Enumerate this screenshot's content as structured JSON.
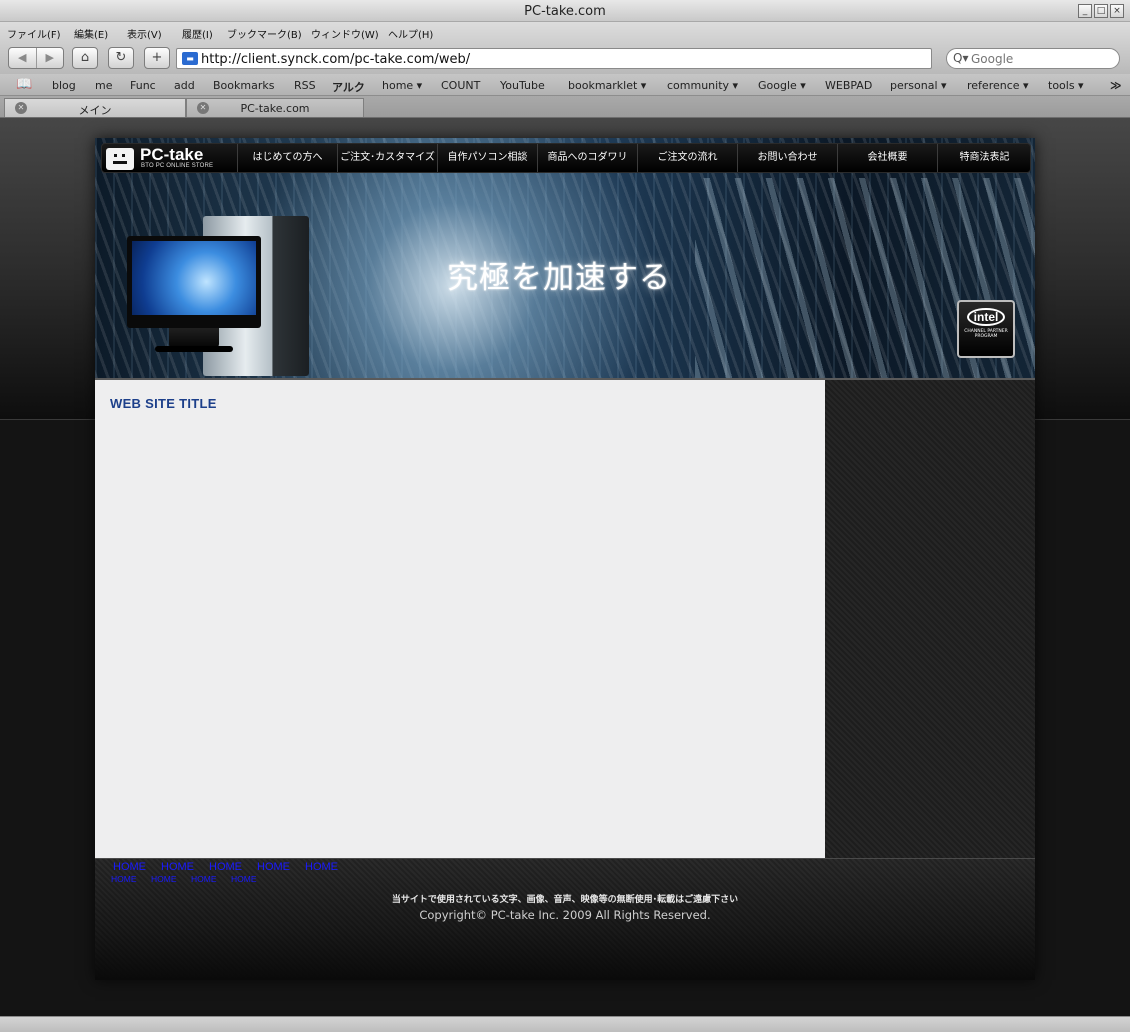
{
  "window": {
    "title": "PC-take.com",
    "buttons": [
      "_",
      "□",
      "×"
    ]
  },
  "menubar": [
    "ファイル(F)",
    "編集(E)",
    "表示(V)",
    "履歴(I)",
    "ブックマーク(B)",
    "ウィンドウ(W)",
    "ヘルプ(H)"
  ],
  "toolbar": {
    "back_icon": "◀",
    "forward_icon": "▶",
    "home_icon": "⌂",
    "reload_icon": "↻",
    "add_icon": "+",
    "url": "http://client.synck.com/pc-take.com/web/",
    "search_placeholder": "Google",
    "search_icon": "Q▾"
  },
  "bookmarks": [
    "blog",
    "me",
    "Func",
    "add",
    "Bookmarks",
    "RSS",
    "アルク",
    "home ▾",
    "COUNT",
    "YouTube",
    "bookmarklet ▾",
    "community ▾",
    "Google ▾",
    "WEBPAD",
    "personal ▾",
    "reference ▾",
    "tools ▾"
  ],
  "bookmarks_overflow": "≫",
  "tabs": [
    {
      "label": "メイン",
      "active": true
    },
    {
      "label": "PC-take.com",
      "active": false
    }
  ],
  "site": {
    "logo": {
      "name": "PC-take",
      "subtitle": "BTO PC ONLINE STORE"
    },
    "nav": [
      "はじめての方へ",
      "ご注文･カスタマイズ",
      "自作パソコン相談",
      "商品へのコダワリ",
      "ご注文の流れ",
      "お問い合わせ",
      "会社概要",
      "特商法表記"
    ],
    "tagline": "究極を加速する",
    "intel_badge": {
      "logo": "intel",
      "text": "CHANNEL PARTNER PROGRAM"
    },
    "content_title": "WEB SITE TITLE",
    "footer": {
      "links_row1": [
        "HOME",
        "HOME",
        "HOME",
        "HOME",
        "HOME"
      ],
      "links_row2": [
        "HOME",
        "HOME",
        "HOME",
        "HOME"
      ],
      "notice": "当サイトで使用されている文字、画像、音声、映像等の無断使用･転載はご遠慮下さい",
      "copyright": "Copyright© PC-take Inc. 2009 All Rights Reserved."
    }
  },
  "colors": {
    "link_blue": "#1a1aff",
    "title_blue": "#1c3f8a",
    "content_bg": "#eeeeef",
    "page_bg": "#141414"
  }
}
